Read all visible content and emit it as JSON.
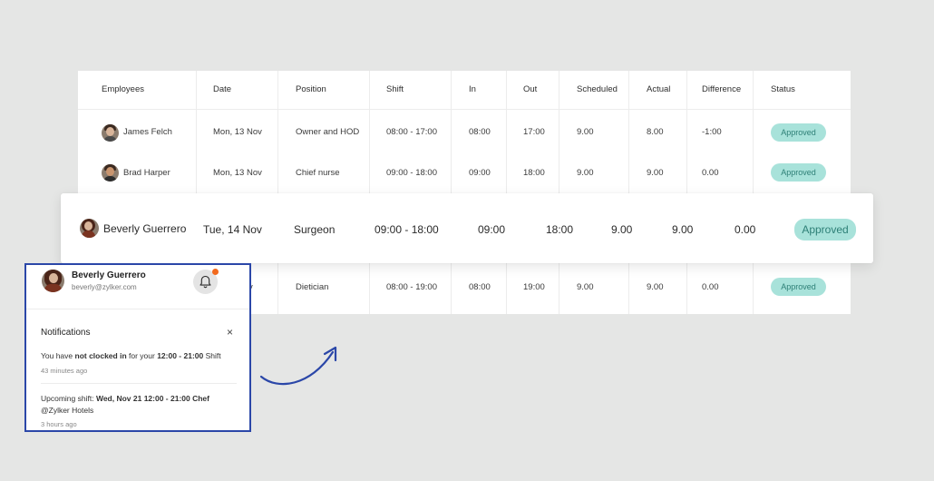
{
  "table": {
    "headers": [
      "Employees",
      "Date",
      "Position",
      "Shift",
      "In",
      "Out",
      "Scheduled",
      "Actual",
      "Difference",
      "Status"
    ],
    "rows": [
      {
        "name": "James Felch",
        "date": "Mon, 13 Nov",
        "position": "Owner and HOD",
        "shift": "08:00 - 17:00",
        "in": "08:00",
        "out": "17:00",
        "scheduled": "9.00",
        "actual": "8.00",
        "difference": "-1:00",
        "status": "Approved"
      },
      {
        "name": "Brad Harper",
        "date": "Mon, 13 Nov",
        "position": "Chief nurse",
        "shift": "09:00 - 18:00",
        "in": "09:00",
        "out": "18:00",
        "scheduled": "9.00",
        "actual": "9.00",
        "difference": "0.00",
        "status": "Approved"
      },
      {
        "name": "",
        "date": "v",
        "position": "Dietician",
        "shift": "08:00 - 19:00",
        "in": "08:00",
        "out": "19:00",
        "scheduled": "9.00",
        "actual": "9.00",
        "difference": "0.00",
        "status": "Approved"
      }
    ]
  },
  "highlight": {
    "name": "Beverly Guerrero",
    "date": "Tue, 14 Nov",
    "position": "Surgeon",
    "shift": "09:00 - 18:00",
    "in": "09:00",
    "out": "18:00",
    "scheduled": "9.00",
    "actual": "9.00",
    "difference": "0.00",
    "status": "Approved"
  },
  "notifications": {
    "user_name": "Beverly Guerrero",
    "user_email": "beverly@zylker.com",
    "title": "Notifications",
    "close_symbol": "×",
    "items": [
      {
        "text_1": "You have ",
        "text_2": "not clocked in",
        "text_3": " for your ",
        "text_4": "12:00 - 21:00",
        "text_5": " Shift",
        "time": "43 minutes ago"
      },
      {
        "text_1": "Upcoming shift: ",
        "text_2": "Wed, Nov 21 12:00 - 21:00 Chef",
        "text_3": "@Zylker Hotels",
        "time": "3 hours ago"
      }
    ]
  },
  "colors": {
    "background": "#e5e6e5",
    "badge_bg": "#a8e2da",
    "badge_text": "#2d7f76",
    "notif_border": "#2b47a8",
    "bell_dot": "#f26a1e",
    "arrow": "#2b47a8"
  },
  "icons": {
    "bell": "bell-icon",
    "close": "close-icon",
    "arrow": "curved-arrow-icon"
  }
}
